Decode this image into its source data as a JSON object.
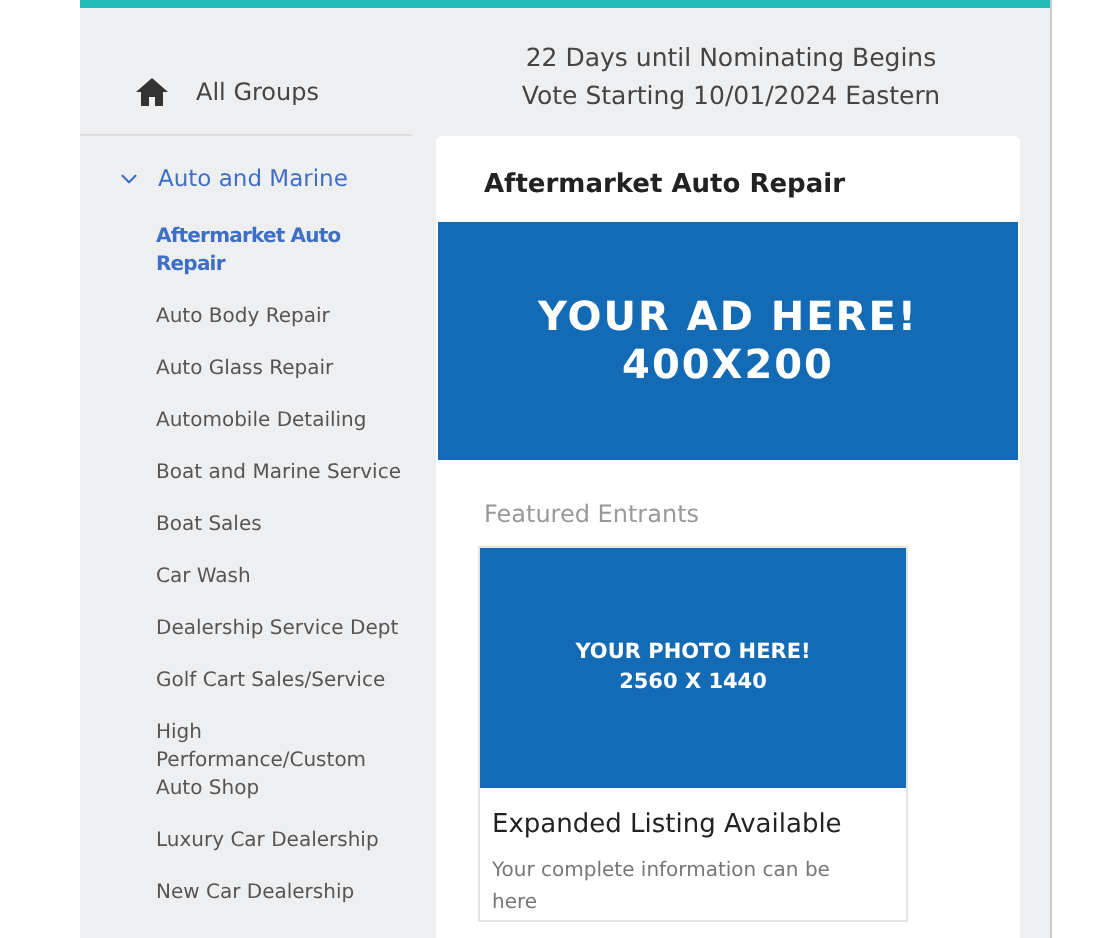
{
  "home_link": {
    "label": "All Groups"
  },
  "countdown": [
    "22 Days until Nominating Begins",
    "Vote Starting 10/01/2024 Eastern"
  ],
  "sidebar": {
    "group": {
      "label": "Auto and Marine",
      "expanded": true
    },
    "items": [
      {
        "label": "Aftermarket Auto Repair",
        "selected": true
      },
      {
        "label": "Auto Body Repair",
        "selected": false
      },
      {
        "label": "Auto Glass Repair",
        "selected": false
      },
      {
        "label": "Automobile Detailing",
        "selected": false
      },
      {
        "label": "Boat and Marine Service",
        "selected": false
      },
      {
        "label": "Boat Sales",
        "selected": false
      },
      {
        "label": "Car Wash",
        "selected": false
      },
      {
        "label": "Dealership Service Dept",
        "selected": false
      },
      {
        "label": "Golf Cart Sales/Service",
        "selected": false
      },
      {
        "label": "High Performance/Custom Auto Shop",
        "selected": false
      },
      {
        "label": "Luxury Car Dealership",
        "selected": false
      },
      {
        "label": "New Car Dealership",
        "selected": false
      }
    ]
  },
  "category": {
    "title": "Aftermarket Auto Repair",
    "ad_banner": [
      "YOUR AD HERE!",
      "400X200"
    ],
    "featured_heading": "Featured Entrants",
    "entrant": {
      "photo_text": [
        "YOUR PHOTO HERE!",
        "2560 X 1440"
      ],
      "title": "Expanded Listing Available",
      "description": "Your complete information can be here"
    }
  }
}
